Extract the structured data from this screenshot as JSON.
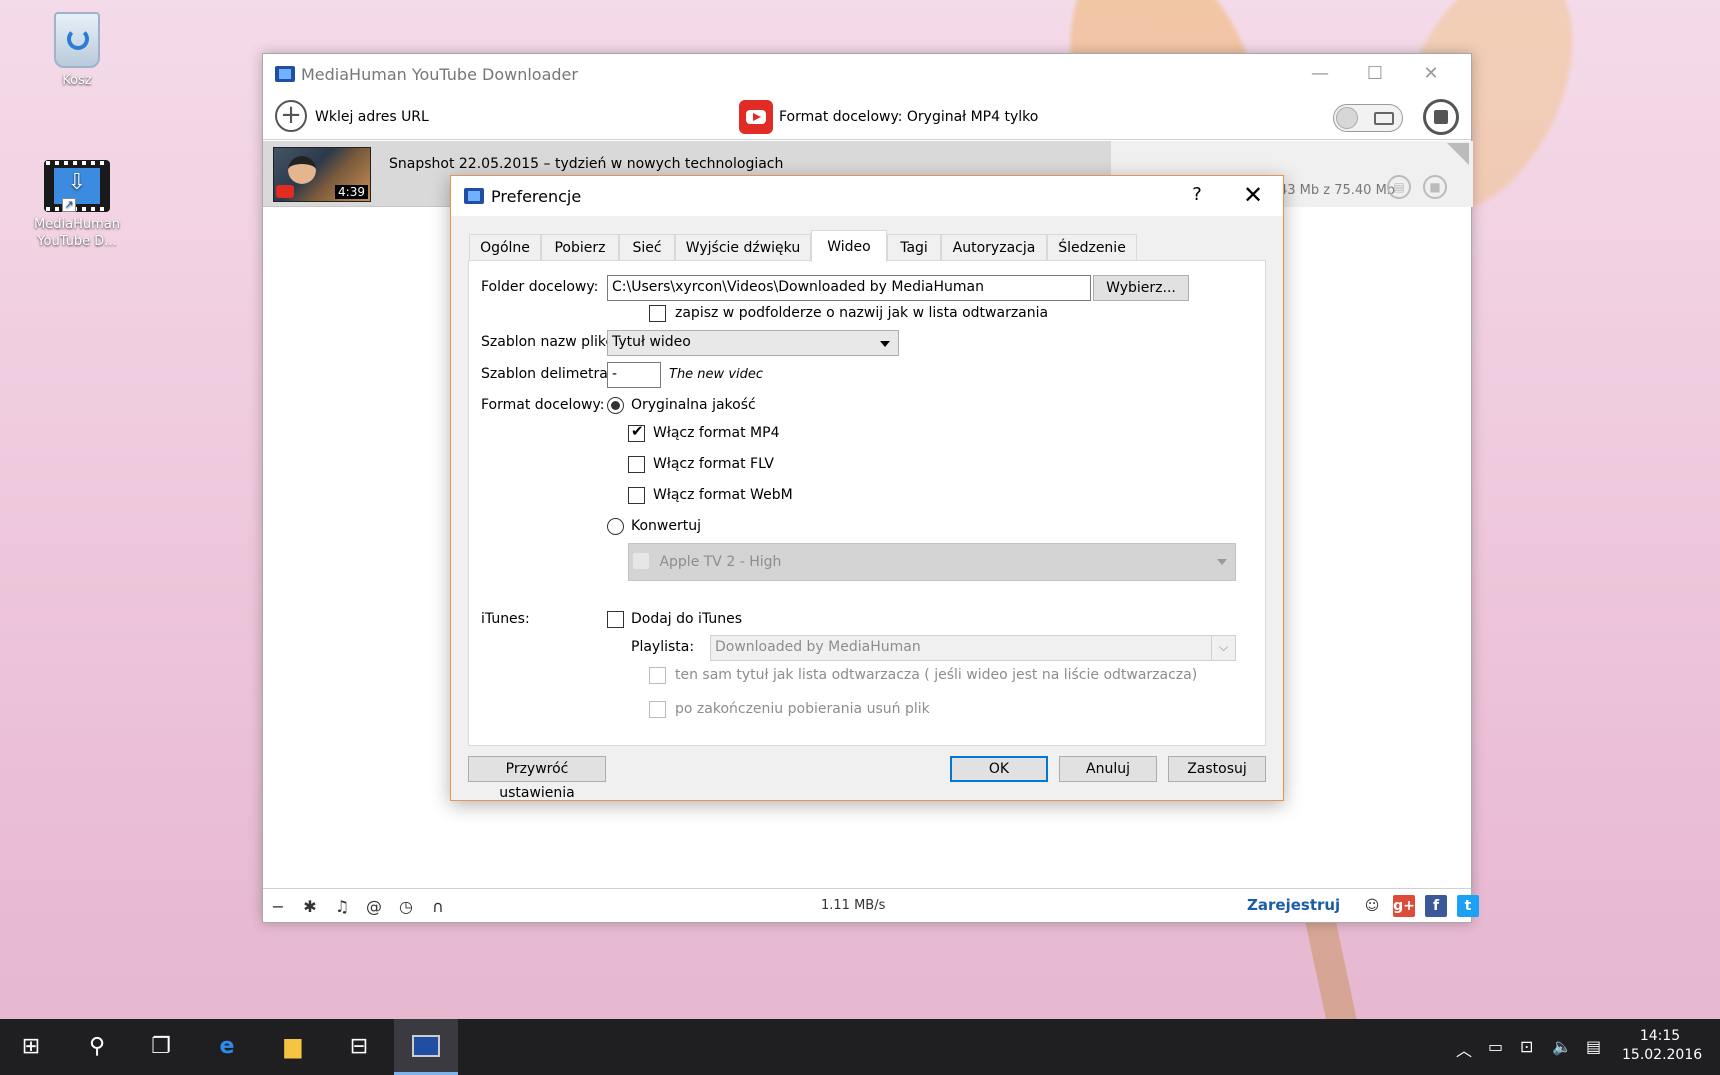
{
  "desktop": {
    "icons": [
      {
        "label": "Kosz"
      },
      {
        "label": "MediaHuman YouTube D..."
      }
    ]
  },
  "main_window": {
    "title": "MediaHuman YouTube Downloader",
    "toolbar": {
      "paste_url_label": "Wklej adres URL",
      "target_format_label": "Format docelowy: Oryginał MP4 tylko"
    },
    "download": {
      "title": "Snapshot 22.05.2015 – tydzień w nowych technologiach",
      "duration": "4:39",
      "size_text": "43 Mb z 75.40 Mb"
    },
    "statusbar": {
      "speed": "1.11 MB/s",
      "register_label": "Zarejestruj"
    }
  },
  "dialog": {
    "title": "Preferencje",
    "help_label": "?",
    "close_label": "✕",
    "tabs": [
      {
        "label": "Ogólne"
      },
      {
        "label": "Pobierz"
      },
      {
        "label": "Sieć"
      },
      {
        "label": "Wyjście dźwięku"
      },
      {
        "label": "Wideo"
      },
      {
        "label": "Tagi"
      },
      {
        "label": "Autoryzacja"
      },
      {
        "label": "Śledzenie"
      }
    ],
    "active_tab": "Wideo",
    "folder": {
      "label": "Folder docelowy:",
      "value": "C:\\Users\\xyrcon\\Videos\\Downloaded by MediaHuman",
      "browse_label": "Wybierz...",
      "subfolder_label": "zapisz w podfolderze o nazwij jak w lista odtwarzania",
      "subfolder_checked": false
    },
    "filename_template": {
      "label": "Szablon nazw plików",
      "value": "Tytuł wideo"
    },
    "delimiter": {
      "label": "Szablon delimetra:",
      "value": "-",
      "preview": "The new videc"
    },
    "target_format": {
      "label": "Format docelowy:",
      "original_label": "Oryginalna jakość",
      "original_selected": true,
      "mp4_label": "Włącz format MP4",
      "mp4_checked": true,
      "flv_label": "Włącz format FLV",
      "flv_checked": false,
      "webm_label": "Włącz format WebM",
      "webm_checked": false,
      "convert_label": "Konwertuj",
      "convert_selected": false,
      "convert_preset": "Apple TV 2 - High"
    },
    "itunes": {
      "label": "iTunes:",
      "add_label": "Dodaj do iTunes",
      "add_checked": false,
      "playlist_label": "Playlista:",
      "playlist_value": "Downloaded by MediaHuman",
      "same_title_label": "ten sam tytuł jak lista odtwarzacza ( jeśli wideo jest na liście odtwarzacza)",
      "delete_after_label": "po zakończeniu pobierania usuń plik"
    },
    "buttons": {
      "restore_label": "Przywróć ustawienia",
      "ok_label": "OK",
      "cancel_label": "Anuluj",
      "apply_label": "Zastosuj"
    }
  },
  "taskbar": {
    "time": "14:15",
    "date": "15.02.2016"
  }
}
